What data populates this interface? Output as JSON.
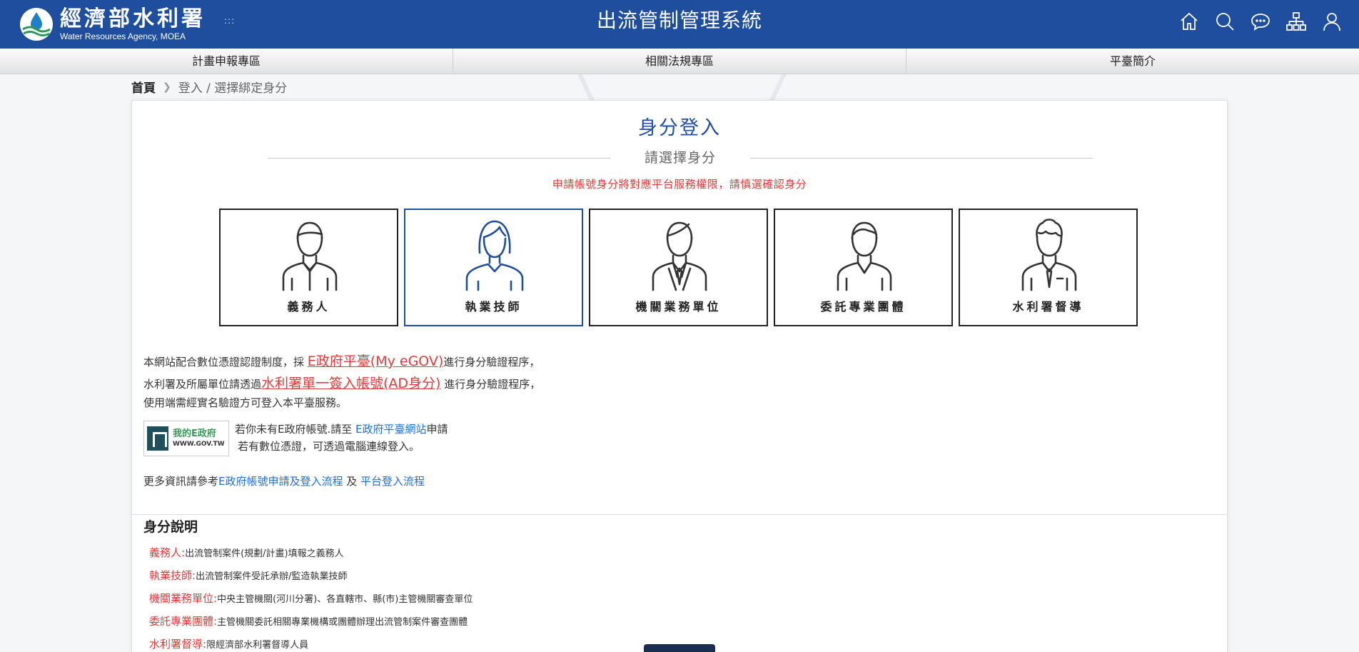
{
  "header": {
    "logo_cn": "經濟部水利署",
    "logo_en": "Water Resources Agency, MOEA",
    "logo_dots": ":::",
    "site_title": "出流管制管理系統",
    "icons": [
      "home-icon",
      "search-icon",
      "chat-icon",
      "sitemap-icon",
      "user-icon"
    ]
  },
  "nav": {
    "items": [
      {
        "label": "計畫申報專區"
      },
      {
        "label": "相關法規專區"
      },
      {
        "label": "平臺簡介"
      }
    ]
  },
  "breadcrumb": {
    "home": "首頁",
    "current": "登入 / 選擇綁定身分"
  },
  "login": {
    "title": "身分登入",
    "subtitle": "請選擇身分",
    "warning": "申請帳號身分將對應平台服務權限，請慎選確認身分",
    "roles": [
      {
        "label": "義務人",
        "selected": false
      },
      {
        "label": "執業技師",
        "selected": true
      },
      {
        "label": "機關業務單位",
        "selected": false
      },
      {
        "label": "委託專業團體",
        "selected": false
      },
      {
        "label": "水利署督導",
        "selected": false
      }
    ]
  },
  "info": {
    "line1_pre": "本網站配合數位憑證認證制度，採 ",
    "line1_link": "E政府平臺(My eGOV)",
    "line1_post": "進行身分驗證程序，",
    "line2_pre": "水利署及所屬單位請透過",
    "line2_link": "水利署單一簽入帳號(AD身分)",
    "line2_post": " 進行身分驗證程序，",
    "line3": "使用端需經實名驗證方可登入本平臺服務。"
  },
  "egov": {
    "badge_title": "我的E政府",
    "badge_url": "WWW.GOV.TW",
    "text1_pre": "若你未有E政府帳號.請至 ",
    "text1_link": "E政府平臺網站",
    "text1_post": "申請",
    "text2": "若有數位憑證，可透過電腦連線登入。"
  },
  "more": {
    "pre": "更多資訊請參考",
    "link1": "E政府帳號申請及登入流程",
    "mid": " 及 ",
    "link2": "平台登入流程"
  },
  "description": {
    "title": "身分說明",
    "items": [
      {
        "key": "義務人:",
        "text": "出流管制案件(規劃/計畫)填報之義務人"
      },
      {
        "key": "執業技師:",
        "text": "出流管制案件受託承辦/監造執業技師"
      },
      {
        "key": "機關業務單位:",
        "text": "中央主管機關(河川分署)、各直轄市、縣(市)主管機關審查單位"
      },
      {
        "key": "委託專業團體:",
        "text": "主管機關委託相關專業機構或團體辦理出流管制案件審查團體"
      },
      {
        "key": "水利署督導:",
        "text": "限經濟部水利署督導人員"
      }
    ]
  },
  "colors": {
    "brand": "#1f4e9f",
    "warning": "#e03a3a",
    "link": "#1f6fcf"
  }
}
